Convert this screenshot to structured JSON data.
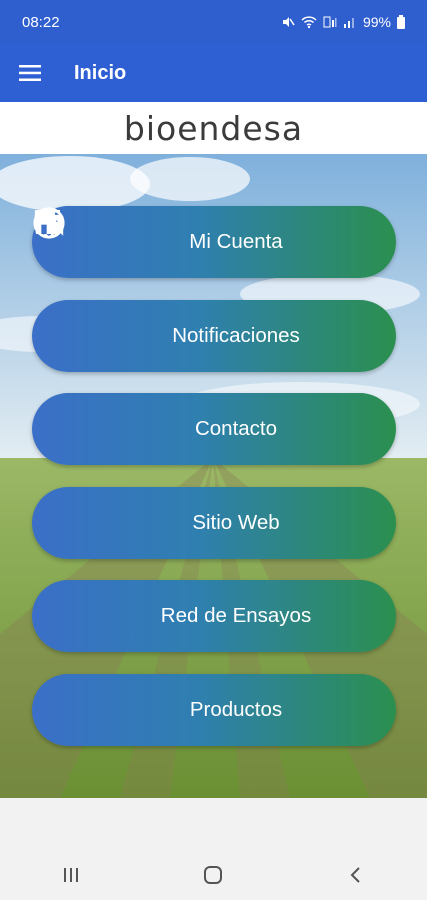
{
  "status_bar": {
    "time": "08:22",
    "battery": "99%",
    "icons": [
      "mute-icon",
      "wifi-icon",
      "volte-icon",
      "signal-icon",
      "battery-icon"
    ]
  },
  "app_bar": {
    "title": "Inicio",
    "menu_icon": "hamburger-menu-icon"
  },
  "brand": {
    "logo": "bioendesa"
  },
  "menu": {
    "items": [
      {
        "label": "Mi Cuenta",
        "icon": "person-icon"
      },
      {
        "label": "Notificaciones",
        "icon": "chat-icon"
      },
      {
        "label": "Contacto",
        "icon": "phone-icon"
      },
      {
        "label": "Sitio Web",
        "icon": "globe-icon"
      },
      {
        "label": "Red de Ensayos",
        "icon": "flask-icon"
      },
      {
        "label": "Productos",
        "icon": "store-icon"
      }
    ]
  },
  "nav_bar": {
    "buttons": [
      "recent-apps-icon",
      "home-icon",
      "back-icon"
    ]
  },
  "colors": {
    "status_bar": "#2f5fcf",
    "app_bar": "#2e5fd3",
    "button_start": "#3b6fc8",
    "button_end": "#2b8f4f"
  }
}
